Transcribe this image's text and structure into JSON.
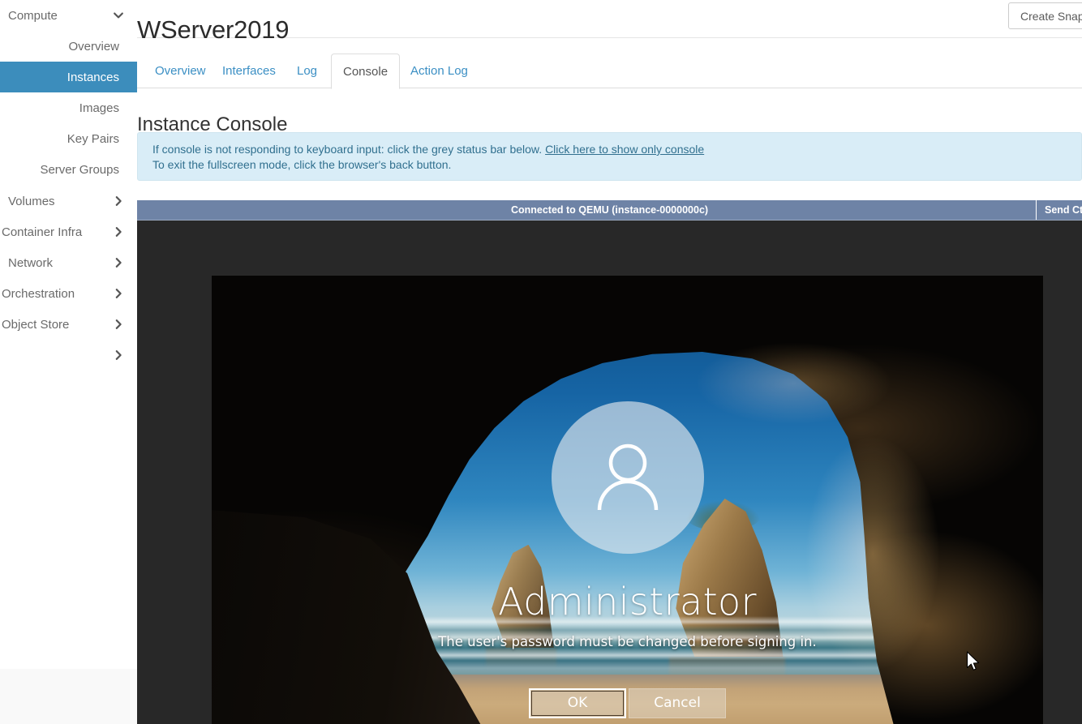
{
  "sidebar": {
    "groups": [
      {
        "label": "Compute",
        "icon": "chevron-down-icon",
        "expanded": true,
        "children": [
          {
            "label": "Overview",
            "active": false
          },
          {
            "label": "Instances",
            "active": true
          },
          {
            "label": "Images",
            "active": false
          },
          {
            "label": "Key Pairs",
            "active": false
          },
          {
            "label": "Server Groups",
            "active": false
          }
        ]
      },
      {
        "label": "Volumes",
        "icon": "chevron-right-icon",
        "expanded": false
      },
      {
        "label": "Container Infra",
        "icon": "chevron-right-icon",
        "expanded": false
      },
      {
        "label": "Network",
        "icon": "chevron-right-icon",
        "expanded": false
      },
      {
        "label": "Orchestration",
        "icon": "chevron-right-icon",
        "expanded": false
      },
      {
        "label": "Object Store",
        "icon": "chevron-right-icon",
        "expanded": false
      },
      {
        "label": "",
        "icon": "chevron-right-icon",
        "expanded": false
      }
    ]
  },
  "header": {
    "title": "WServer2019",
    "create_snapshot_label": "Create Snapshot"
  },
  "tabs": [
    {
      "label": "Overview",
      "active": false
    },
    {
      "label": "Interfaces",
      "active": false
    },
    {
      "label": "Log",
      "active": false
    },
    {
      "label": "Console",
      "active": true
    },
    {
      "label": "Action Log",
      "active": false
    }
  ],
  "section": {
    "title": "Instance Console"
  },
  "alert": {
    "line1_prefix": "If console is not responding to keyboard input: click the grey status bar below.",
    "line1_link": "Click here to show only console",
    "line2": "To exit the fullscreen mode, click the browser's back button."
  },
  "console": {
    "status_text": "Connected to QEMU (instance-0000000c)",
    "send_ctrl_label": "Send CtrlAltDel",
    "status_bar_color": "#6e83a6",
    "body_color": "#282828"
  },
  "vm": {
    "username": "Administrator",
    "message": "The user's password must be changed before signing in.",
    "avatar_icon": "person-icon",
    "buttons": [
      {
        "label": "OK",
        "focused": true
      },
      {
        "label": "Cancel",
        "focused": false
      }
    ],
    "cursor_icon": "mouse-pointer-icon"
  },
  "colors": {
    "accent_blue": "#3c8dbc",
    "link_blue": "#3b8fc4",
    "alert_bg": "#d9edf7",
    "alert_text": "#31708f"
  }
}
